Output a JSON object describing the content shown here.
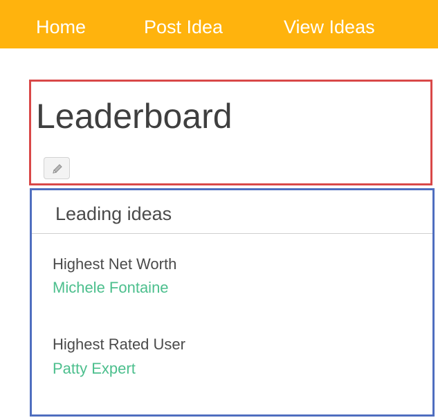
{
  "nav": {
    "items": [
      {
        "label": "Home"
      },
      {
        "label": "Post Idea"
      },
      {
        "label": "View Ideas"
      }
    ],
    "background_color": "#ffb30d"
  },
  "header": {
    "title": "Leaderboard",
    "edit_icon": "pencil-icon"
  },
  "leading_ideas": {
    "title": "Leading ideas",
    "stats": [
      {
        "label": "Highest Net Worth",
        "value": "Michele Fontaine"
      },
      {
        "label": "Highest Rated User",
        "value": "Patty Expert"
      }
    ],
    "value_color": "#4cbf8d"
  },
  "highlight_colors": {
    "title_box": "#d94848",
    "ideas_box": "#4f6ebf"
  }
}
